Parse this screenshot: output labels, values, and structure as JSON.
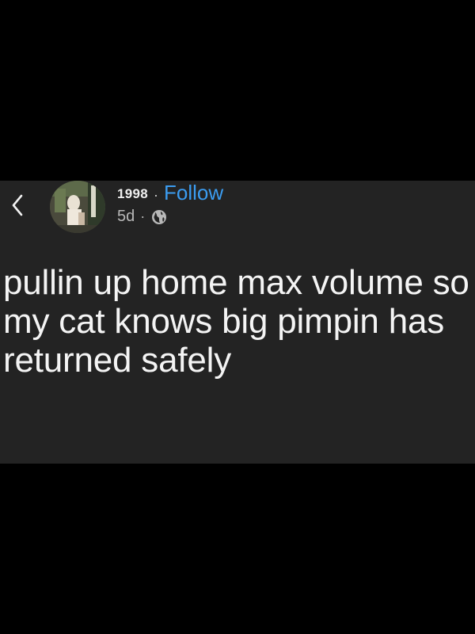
{
  "post": {
    "author": "1998",
    "separator": "·",
    "follow_label": "Follow",
    "timestamp": "5d",
    "time_separator": "·",
    "audience_icon": "globe-icon",
    "body": "pullin up home max volume so my cat knows big pimpin has returned safely"
  },
  "navigation": {
    "back_icon": "chevron-left-icon"
  },
  "colors": {
    "background": "#000000",
    "card": "#232323",
    "text": "#f4f4f4",
    "muted": "#b8b8b8",
    "follow": "#3b9cf0"
  }
}
